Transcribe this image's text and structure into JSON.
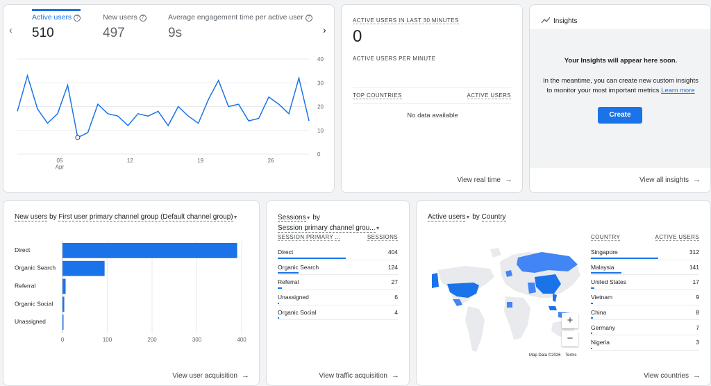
{
  "overview": {
    "metrics": [
      {
        "label": "Active users",
        "value": "510"
      },
      {
        "label": "New users",
        "value": "497"
      },
      {
        "label": "Average engagement time per active user",
        "value": "9s"
      }
    ],
    "prev_icon": "chevron-left-icon",
    "next_icon": "chevron-right-icon",
    "y_ticks": [
      "40",
      "30",
      "20",
      "10",
      "0"
    ],
    "x_ticks": [
      "05",
      "12",
      "19",
      "26"
    ],
    "x_month": "Apr",
    "chart_data": {
      "type": "line",
      "series": [
        {
          "values": [
            18,
            33,
            19,
            13,
            17,
            29,
            7,
            9,
            21,
            17,
            16,
            12,
            17,
            16,
            18,
            12,
            20,
            16,
            13,
            23,
            31,
            20,
            21,
            14,
            15,
            24,
            21,
            17,
            32,
            14
          ]
        }
      ],
      "ylim": [
        0,
        40
      ],
      "highlight_index": 6,
      "grid": true
    }
  },
  "realtime": {
    "heading": "ACTIVE USERS IN LAST 30 MINUTES",
    "value": "0",
    "per_minute": "ACTIVE USERS PER MINUTE",
    "col1": "TOP COUNTRIES",
    "col2": "ACTIVE USERS",
    "empty": "No data available",
    "link": "View real time"
  },
  "insights": {
    "title": "Insights",
    "icon": "insights-sparkle-icon",
    "headline": "Your Insights will appear here soon.",
    "body": "In the meantime, you can create new custom insights to monitor your most important metrics.",
    "learn_more": "Learn more",
    "button": "Create",
    "link": "View all insights"
  },
  "acquisition": {
    "metric": "New users",
    "by": "by",
    "dimension": "First user primary channel group (Default channel group)",
    "x_ticks": [
      "0",
      "100",
      "200",
      "300",
      "400"
    ],
    "link": "View user acquisition",
    "chart_data": {
      "type": "bar",
      "orientation": "horizontal",
      "categories": [
        "Direct",
        "Organic Search",
        "Referral",
        "Organic Social",
        "Unassigned"
      ],
      "values": [
        390,
        94,
        7,
        4,
        2
      ],
      "xlim": [
        0,
        400
      ],
      "grid": true
    }
  },
  "traffic": {
    "metric": "Sessions",
    "by": "by",
    "dimension": "Session primary channel grou...",
    "col1": "SESSION PRIMARY ...",
    "col2": "SESSIONS",
    "rows": [
      {
        "name": "Direct",
        "value": "404",
        "share": 0.78
      },
      {
        "name": "Organic Search",
        "value": "124",
        "share": 0.24
      },
      {
        "name": "Referral",
        "value": "27",
        "share": 0.05
      },
      {
        "name": "Unassigned",
        "value": "6",
        "share": 0.012
      },
      {
        "name": "Organic Social",
        "value": "4",
        "share": 0.008
      }
    ],
    "link": "View traffic acquisition"
  },
  "countries": {
    "metric": "Active users",
    "by": "by",
    "dimension": "Country",
    "col1": "COUNTRY",
    "col2": "ACTIVE USERS",
    "rows": [
      {
        "name": "Singapore",
        "value": "312",
        "share": 1.0
      },
      {
        "name": "Malaysia",
        "value": "141",
        "share": 0.45
      },
      {
        "name": "United States",
        "value": "17",
        "share": 0.055
      },
      {
        "name": "Vietnam",
        "value": "9",
        "share": 0.03
      },
      {
        "name": "China",
        "value": "8",
        "share": 0.026
      },
      {
        "name": "Germany",
        "value": "7",
        "share": 0.022
      },
      {
        "name": "Nigeria",
        "value": "3",
        "share": 0.01
      }
    ],
    "zoom_in": "+",
    "zoom_out": "−",
    "map_credit": "Map Data ©2026",
    "terms": "Terms",
    "link": "View countries"
  }
}
